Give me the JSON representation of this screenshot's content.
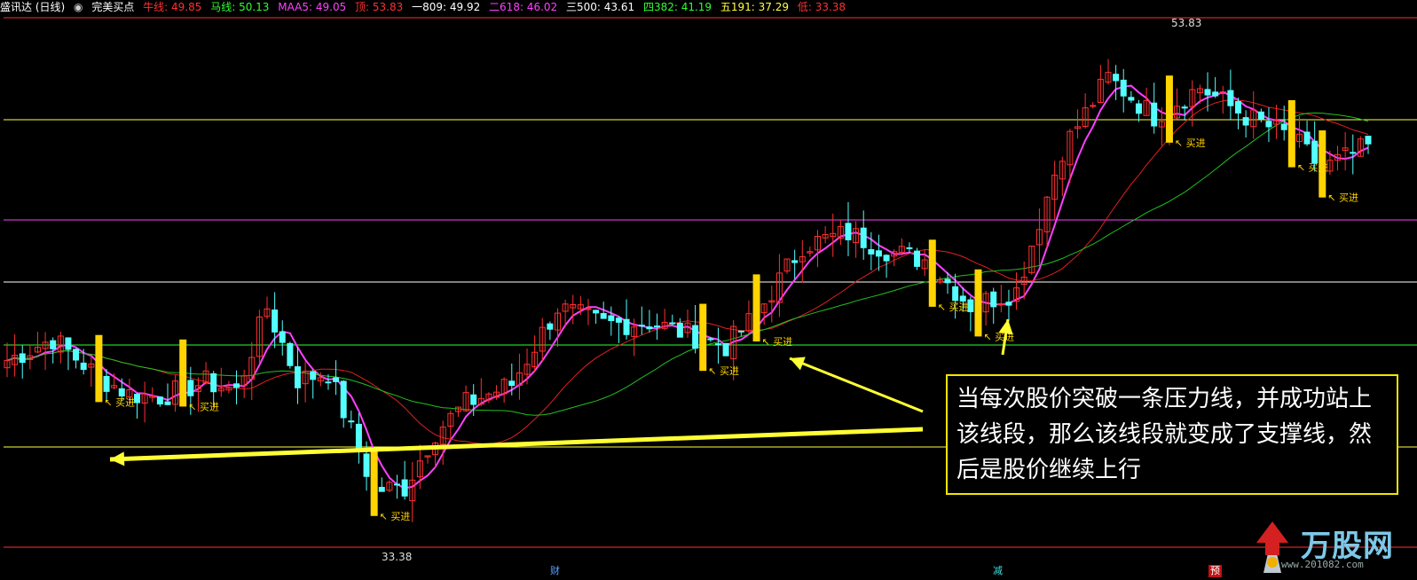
{
  "header": {
    "app_title": "盛讯达 (日线)",
    "formula_name": "完美买点",
    "items": [
      {
        "label": "牛线: 49.85",
        "color": "#ff3030"
      },
      {
        "label": "马线: 50.13",
        "color": "#30ff30"
      },
      {
        "label": "MAA5: 49.05",
        "color": "#ff40ff"
      },
      {
        "label": "顶: 53.83",
        "color": "#ff3030"
      },
      {
        "label": "一809: 49.92",
        "color": "#ffffff"
      },
      {
        "label": "二618: 46.02",
        "color": "#ff40ff"
      },
      {
        "label": "三500: 43.61",
        "color": "#ffffff"
      },
      {
        "label": "四382: 41.19",
        "color": "#30ff30"
      },
      {
        "label": "五191: 37.29",
        "color": "#ffff40"
      },
      {
        "label": "低: 33.38",
        "color": "#ff3030"
      }
    ]
  },
  "chart_data": {
    "type": "candlestick",
    "high_label": "53.83",
    "low_label": "33.38",
    "ylim": [
      32.5,
      54.6
    ],
    "levels": [
      {
        "name": "顶",
        "value": 53.83,
        "color": "#ff3030"
      },
      {
        "name": "一809",
        "value": 49.92,
        "color": "#ffff40"
      },
      {
        "name": "二618",
        "value": 46.02,
        "color": "#ff40ff"
      },
      {
        "name": "三500",
        "value": 43.61,
        "color": "#ffffff"
      },
      {
        "name": "四382",
        "value": 41.19,
        "color": "#30ff30"
      },
      {
        "name": "五191",
        "value": 37.29,
        "color": "#ffff40"
      },
      {
        "name": "低",
        "value": 33.38,
        "color": "#ff3030"
      }
    ],
    "series": [
      {
        "name": "MAA5",
        "color": "#ff40ff"
      },
      {
        "name": "牛线",
        "color": "#e02020"
      },
      {
        "name": "马线",
        "color": "#20c020"
      }
    ],
    "buy_signal_label": "买进",
    "footer_markers": [
      {
        "text": "财",
        "color": "#5aa0ff"
      },
      {
        "text": "减",
        "color": "#40e0e0"
      },
      {
        "text": "预",
        "color": "#ff3030"
      }
    ]
  },
  "annotation": {
    "text": "当每次股价突破一条压力线，并成功站上该线段，那么该线段就变成了支撑线，然后是股价继续上行"
  },
  "watermark": {
    "brand": "万股网",
    "url": "www.201082.com"
  }
}
